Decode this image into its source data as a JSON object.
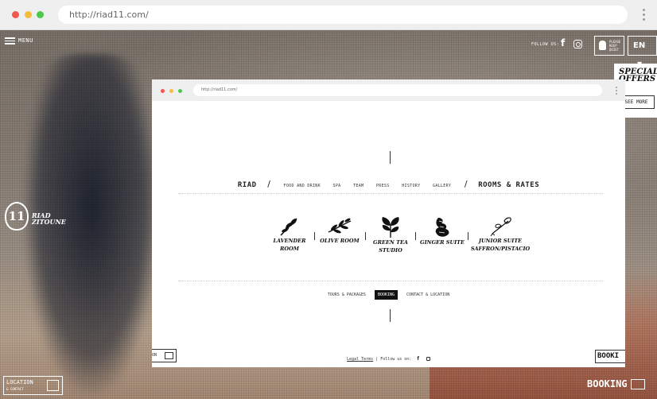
{
  "browser": {
    "url": "http://riad11.com/"
  },
  "site": {
    "menu_label": "MENU",
    "follow_label": "FOLLOW US:",
    "keep_quiet": "PLEASE KEEP QUIET",
    "language": "EN",
    "special_offers": "SPECIAL OFFERS",
    "see_more": "SEE MORE",
    "logo_number": "11",
    "logo_name_1": "RIAD",
    "logo_name_2": "ZITOUNE",
    "location_label": "LOCATION",
    "location_sub": "& CONTACT",
    "booking_label": "BOOKING"
  },
  "popup": {
    "url": "http://riad11.com/",
    "nav": {
      "riad": "RIAD",
      "sep": "/",
      "items": [
        "FOOD AND DRINK",
        "SPA",
        "TEAM",
        "PRESS",
        "HISTORY",
        "GALLERY"
      ],
      "rooms_rates": "ROOMS & RATES"
    },
    "rooms": [
      {
        "line1": "LAVENDER",
        "line2": "ROOM"
      },
      {
        "line1": "OLIVE ROOM",
        "line2": ""
      },
      {
        "line1": "GREEN TEA",
        "line2": "STUDIO"
      },
      {
        "line1": "GINGER SUITE",
        "line2": ""
      },
      {
        "line1": "JUNIOR SUITE",
        "line2": "SAFFRON/PISTACIO"
      }
    ],
    "subnav": [
      "TOURS & PACKAGES",
      "BOOKING",
      "CONTACT & LOCATION"
    ],
    "footer": {
      "legal": "Legal Terms",
      "follow": "Follow us on:",
      "fb": "f"
    },
    "location_short": "ON",
    "booking_cut": "BOOKI"
  },
  "colors": {
    "accent": "#111111",
    "active_bg": "#111111",
    "chrome": "#efefef"
  }
}
